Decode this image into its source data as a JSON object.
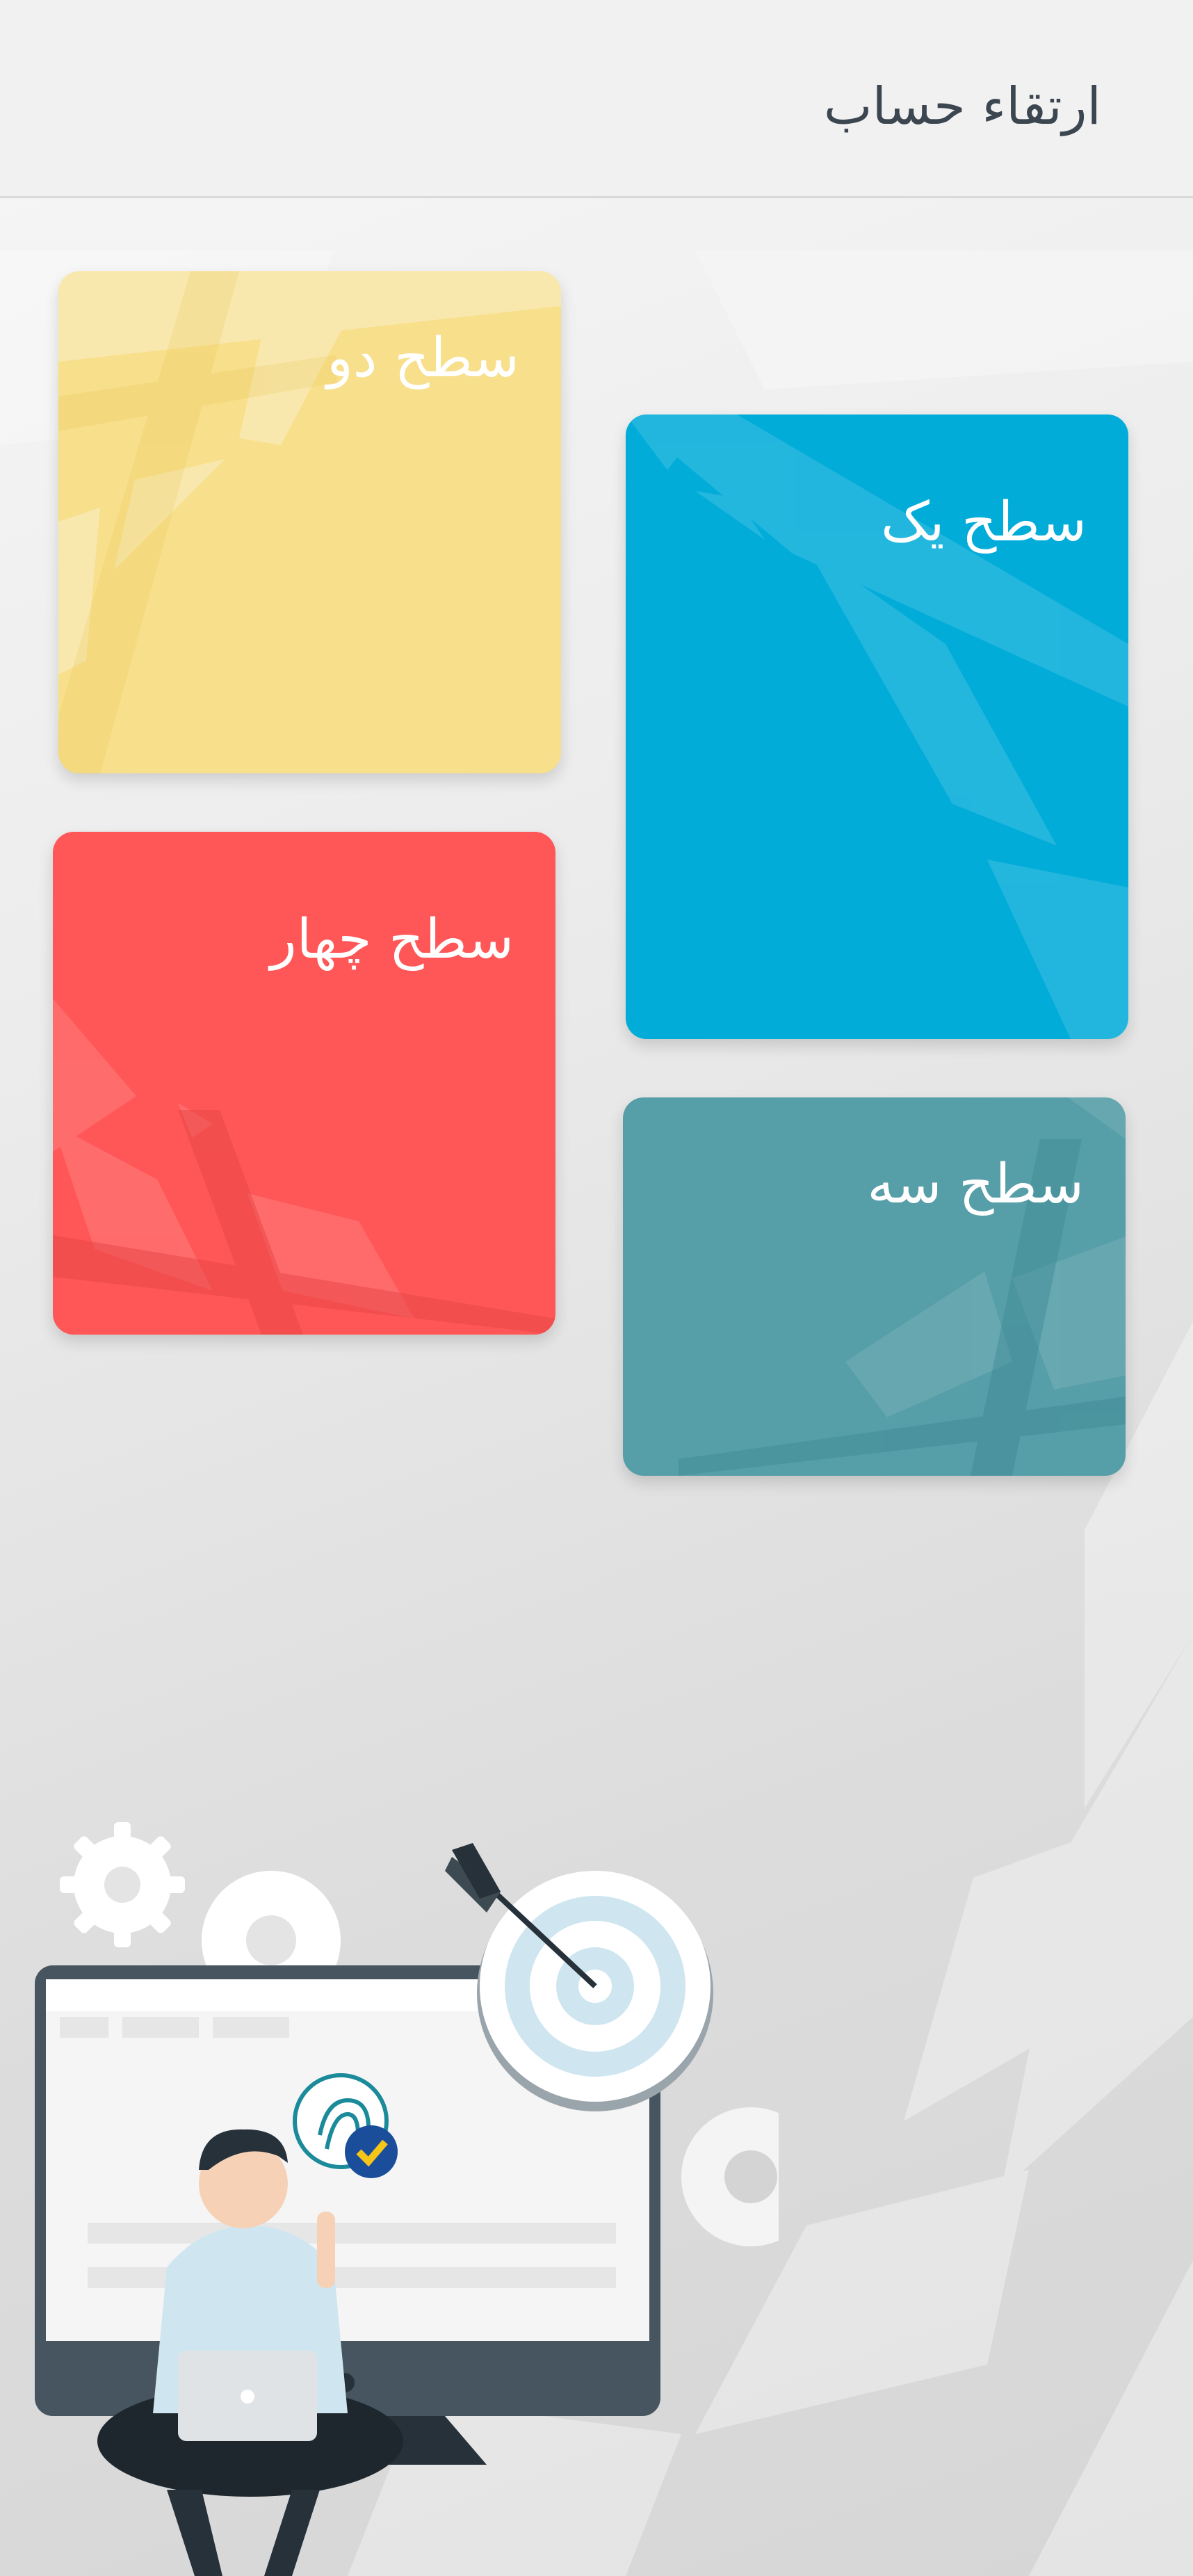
{
  "header": {
    "title": "ارتقاء حساب"
  },
  "levels": [
    {
      "label": "سطح یک",
      "color": "#02acd9"
    },
    {
      "label": "سطح دو",
      "color": "#f7df8b"
    },
    {
      "label": "سطح سه",
      "color": "#569ea8"
    },
    {
      "label": "سطح چهار",
      "color": "#ff5757"
    }
  ],
  "icons": {
    "illustration": "person-with-laptop-illustration",
    "target": "target-icon",
    "fingerprint": "fingerprint-icon",
    "check": "check-icon",
    "gears": "gear-icon"
  }
}
